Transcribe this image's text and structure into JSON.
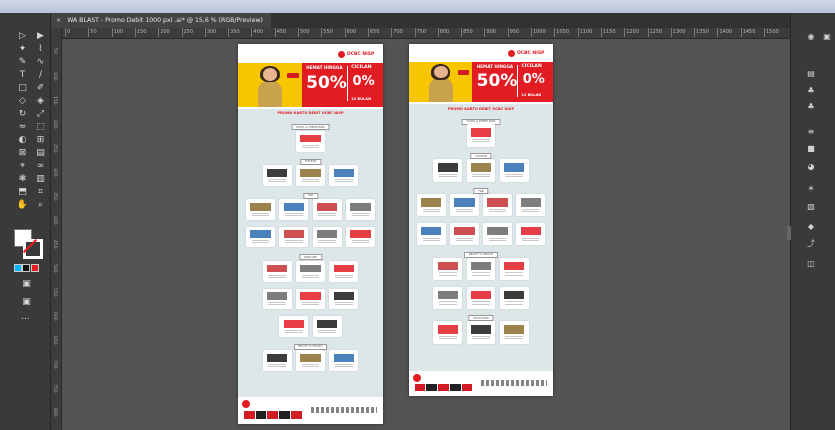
{
  "document": {
    "tab_title": "WA BLAST - Promo Debit 1000 pxl .ai* @ 15,6 % (RGB/Preview)",
    "close_glyph": "×"
  },
  "rulers": {
    "top": [
      "0",
      "50",
      "100",
      "150",
      "200",
      "250",
      "300",
      "350",
      "400",
      "450",
      "500",
      "550",
      "600",
      "650",
      "700",
      "750",
      "800",
      "850",
      "900",
      "950",
      "1000",
      "1050",
      "1100",
      "1150",
      "1200",
      "1250",
      "1300",
      "1350",
      "1400",
      "1450",
      "1500"
    ],
    "left": [
      "50",
      "100",
      "150",
      "200",
      "250",
      "300",
      "350",
      "400",
      "450",
      "500",
      "550",
      "600",
      "650",
      "700",
      "750",
      "800"
    ]
  },
  "toolbar": {
    "tools": [
      "selection-tool",
      "direct-selection-tool",
      "magic-wand-tool",
      "lasso-tool",
      "pen-tool",
      "curvature-tool",
      "type-tool",
      "line-tool",
      "rectangle-tool",
      "paintbrush-tool",
      "shaper-tool",
      "eraser-tool",
      "rotate-tool",
      "scale-tool",
      "width-tool",
      "free-transform-tool",
      "shape-builder-tool",
      "perspective-grid-tool",
      "mesh-tool",
      "gradient-tool",
      "eyedropper-tool",
      "blend-tool",
      "symbol-sprayer-tool",
      "column-graph-tool",
      "artboard-tool",
      "slice-tool",
      "hand-tool",
      "zoom-tool"
    ],
    "fill_color": "#ffffff",
    "stroke_color": "#e21c23",
    "more_label": "..."
  },
  "right_panel": {
    "icons": [
      "layers-icon",
      "libraries-icon",
      "properties-icon",
      "symbols-icon",
      "clubs-icon",
      "stroke-icon",
      "gradient-icon",
      "transparency-icon",
      "appearance-icon",
      "graphic-styles-icon",
      "swatches-icon",
      "export-icon",
      "pathfinder-icon"
    ]
  },
  "artboards": [
    {
      "bank_name": "OCBC NISP",
      "banner_left_title": "HEMAT HINGGA",
      "banner_left_value": "50%",
      "banner_right_title": "CICILAN",
      "banner_right_value": "0%",
      "banner_right_sub": "12 BULAN",
      "section_title": "PROMO KARTU DEBIT OCBC NISP",
      "categories": [
        "HOTEL & THEME PARK",
        "FASHION",
        "F&B",
        "SKINCARE",
        "BEAUTY & HEALTH",
        "EDUCATION",
        "SPORTS",
        "OTHER"
      ],
      "brands": [
        "HYPERMART",
        "MAXX",
        "FIRST CRACK",
        "ERHA",
        "HALE",
        "FENIUM",
        "SAAB",
        "PURITY",
        "halodoc",
        "ERAFONE"
      ]
    },
    {
      "bank_name": "OCBC NISP",
      "banner_left_title": "HEMAT HINGGA",
      "banner_left_value": "50%",
      "banner_right_title": "CICILAN",
      "banner_right_value": "0%",
      "banner_right_sub": "12 BULAN",
      "section_title": "PROMO KARTU DEBIT OCBC NISP",
      "categories": [
        "HOTEL & THEME PARK",
        "FASHION",
        "F&B",
        "BEAUTY & HEALTH",
        "EDUCATION",
        "SPORTS",
        "OTHER"
      ],
      "brands": [
        "HYPERMART",
        "MAXX",
        "FIRST CRACK",
        "ERHA",
        "HALE",
        "FENIUM",
        "PURITY",
        "halodoc"
      ]
    }
  ]
}
